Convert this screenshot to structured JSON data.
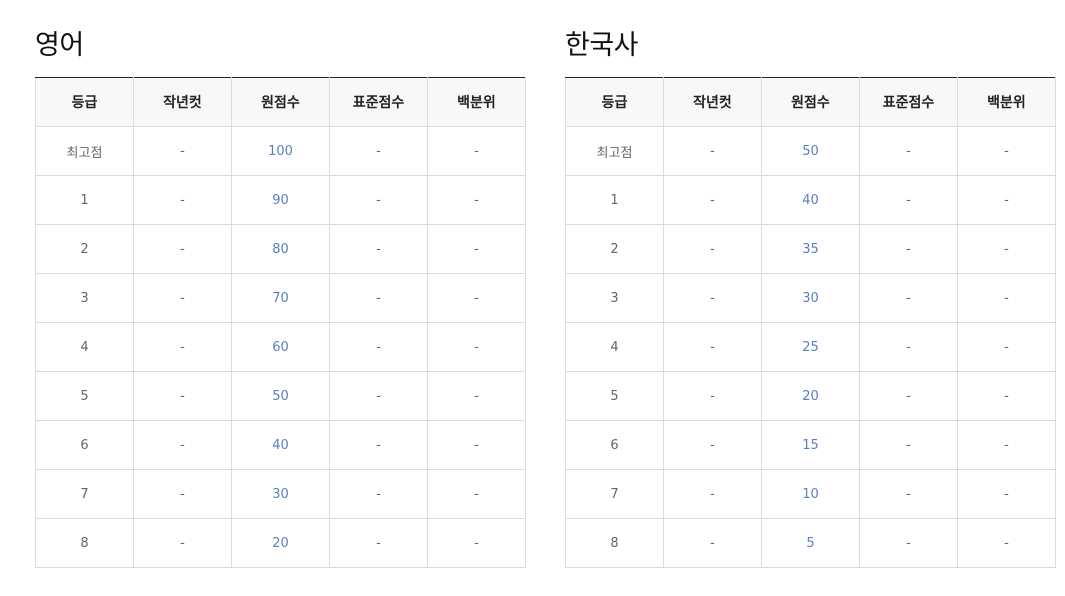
{
  "headers": [
    "등급",
    "작년컷",
    "원점수",
    "표준점수",
    "백분위"
  ],
  "tables": [
    {
      "title": "영어",
      "rows": [
        [
          "최고점",
          "-",
          "100",
          "-",
          "-"
        ],
        [
          "1",
          "-",
          "90",
          "-",
          "-"
        ],
        [
          "2",
          "-",
          "80",
          "-",
          "-"
        ],
        [
          "3",
          "-",
          "70",
          "-",
          "-"
        ],
        [
          "4",
          "-",
          "60",
          "-",
          "-"
        ],
        [
          "5",
          "-",
          "50",
          "-",
          "-"
        ],
        [
          "6",
          "-",
          "40",
          "-",
          "-"
        ],
        [
          "7",
          "-",
          "30",
          "-",
          "-"
        ],
        [
          "8",
          "-",
          "20",
          "-",
          "-"
        ]
      ]
    },
    {
      "title": "한국사",
      "rows": [
        [
          "최고점",
          "-",
          "50",
          "-",
          "-"
        ],
        [
          "1",
          "-",
          "40",
          "-",
          "-"
        ],
        [
          "2",
          "-",
          "35",
          "-",
          "-"
        ],
        [
          "3",
          "-",
          "30",
          "-",
          "-"
        ],
        [
          "4",
          "-",
          "25",
          "-",
          "-"
        ],
        [
          "5",
          "-",
          "20",
          "-",
          "-"
        ],
        [
          "6",
          "-",
          "15",
          "-",
          "-"
        ],
        [
          "7",
          "-",
          "10",
          "-",
          "-"
        ],
        [
          "8",
          "-",
          "5",
          "-",
          "-"
        ]
      ]
    }
  ],
  "colors": {
    "raw_score_text": "#5a7ec0",
    "header_bg": "#f8f8f8",
    "cell_text": "#666666",
    "border": "#dcdcdc",
    "top_rule": "#222222"
  }
}
